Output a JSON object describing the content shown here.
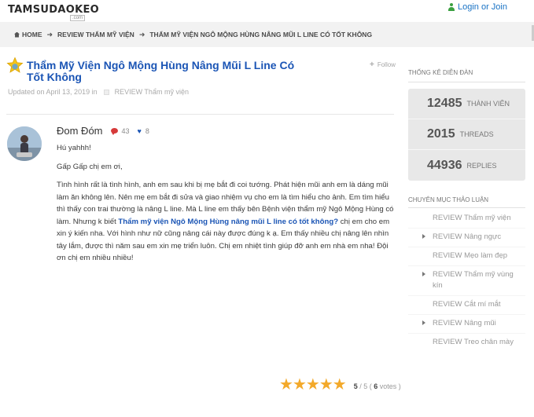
{
  "header": {
    "logo_text": "TAMSUDAOKEO",
    "logo_tag": ".com",
    "login_label": "Login or Join"
  },
  "breadcrumb": [
    {
      "label": "HOME"
    },
    {
      "label": "REVIEW THẨM MỸ VIỆN"
    },
    {
      "label": "THẨM MỸ VIỆN NGÔ MỘNG HÙNG NÂNG MŨI L LINE CÓ TỐT KHÔNG"
    }
  ],
  "thread": {
    "title": "Thẩm Mỹ Viện Ngô Mộng Hùng Nâng Mũi L Line Có Tốt Không",
    "follow_label": "Follow",
    "updated_prefix": "Updated on April 13, 2019 in",
    "category": "REVIEW Thẩm mỹ viện"
  },
  "post": {
    "author": "Đom Đóm",
    "comment_count": "43",
    "like_count": "8",
    "greeting": "Hú yahhh!",
    "line2": "Gấp Gấp chị em ơi,",
    "para_before_link": "Tình hình rất là tình hình, anh em sau khi bị mẹ bắt đi coi tướng. Phát hiện mũi anh em là dáng mũi làm ăn không lên. Nên mẹ em bắt đi sửa và giao nhiệm vụ cho em là tìm hiểu cho ảnh. Em tìm hiểu thì thấy con trai thường là nâng L line. Mà L line em thấy bên Bệnh viện thẩm mỹ Ngô Mộng Hùng có làm. Nhưng k biết ",
    "link_text": "Thẩm mỹ viện Ngô Mộng Hùng nâng mũi L line có tốt không?",
    "para_after_link": " chị em cho em xin ý kiến nha. Với hình như nữ cũng nâng cái này được đúng k ạ. Em thấy nhiều chị nâng lên nhìn tây lắm, được thì năm sau em xin mẹ triển luôn. Chị em nhiệt tình giúp đỡ anh em nhà em nha! Đội ơn chị em nhiều nhiều!"
  },
  "rating": {
    "score": "5",
    "max": "5",
    "votes": "6",
    "votes_label": "votes",
    "stars_filled": 5,
    "star_color": "#f3a92a"
  },
  "sidebar": {
    "stats_heading": "THỐNG KÊ DIỄN ĐÀN",
    "stats": [
      {
        "number": "12485",
        "label": "THÀNH VIÊN"
      },
      {
        "number": "2015",
        "label": "THREADS"
      },
      {
        "number": "44936",
        "label": "REPLIES"
      }
    ],
    "categories_heading": "CHUYÊN MỤC THẢO LUẬN",
    "categories": [
      {
        "label": "REVIEW Thẩm mỹ viện",
        "has_children": false
      },
      {
        "label": "REVIEW Nâng ngực",
        "has_children": true
      },
      {
        "label": "REVIEW Mẹo làm đẹp",
        "has_children": false
      },
      {
        "label": "REVIEW Thẩm mỹ vùng kín",
        "has_children": true
      },
      {
        "label": "REVIEW Cắt mí mắt",
        "has_children": false
      },
      {
        "label": "REVIEW Nâng mũi",
        "has_children": true
      },
      {
        "label": "REVIEW Treo chân mày",
        "has_children": false
      }
    ]
  },
  "colors": {
    "link_blue": "#1b55b5",
    "login_blue": "#1a73c5",
    "icon_green": "#3aa040",
    "comment_red": "#d63a3a",
    "stats_bg": "#e8e8e8"
  }
}
